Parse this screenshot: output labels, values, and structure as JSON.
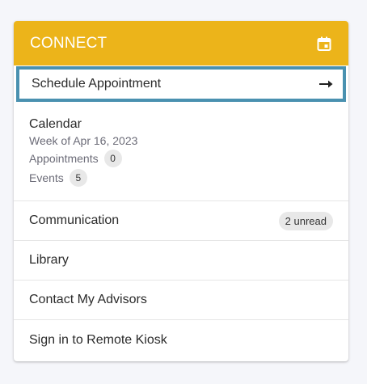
{
  "colors": {
    "header_bg": "#ecb41a",
    "focus_ring": "#4a91b0"
  },
  "header": {
    "title": "CONNECT",
    "icon": "calendar-icon"
  },
  "schedule": {
    "label": "Schedule Appointment",
    "icon": "arrow-right-icon"
  },
  "calendar": {
    "title": "Calendar",
    "week": "Week of Apr 16, 2023",
    "appointments_label": "Appointments",
    "appointments_count": "0",
    "events_label": "Events",
    "events_count": "5"
  },
  "communication": {
    "label": "Communication",
    "badge": "2 unread"
  },
  "library": {
    "label": "Library"
  },
  "advisors": {
    "label": "Contact My Advisors"
  },
  "kiosk": {
    "label": "Sign in to Remote Kiosk"
  }
}
